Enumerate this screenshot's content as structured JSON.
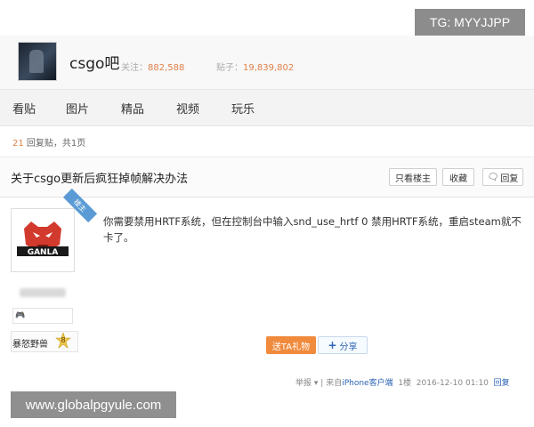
{
  "watermark_top": "TG: MYYJJPP",
  "watermark_bottom": "www.globalpgyule.com",
  "forum": {
    "name": "csgo吧",
    "follow_label": "关注：",
    "follow_count": "882,588",
    "posts_label": "贴子：",
    "posts_count": "19,839,802"
  },
  "nav": [
    "看贴",
    "图片",
    "精品",
    "视频",
    "玩乐"
  ],
  "reply_info": {
    "count": "21",
    "suffix": "回复贴，共1页"
  },
  "thread": {
    "title": "关于csgo更新后疯狂掉帧解决办法",
    "buttons": {
      "only_op": "只看楼主",
      "favorite": "收藏",
      "reply": "回复"
    }
  },
  "user": {
    "corner_tag": "楼主",
    "avatar_text": "GANLA",
    "badge": "🎮",
    "level_name": "暴怒野兽",
    "level": "8"
  },
  "post": {
    "text": "你需要禁用HRTF系统，但在控制台中输入snd_use_hrtf 0 禁用HRTF系统，重启steam就不卡了。",
    "gift_label": "送TA礼物",
    "share_label": "分享"
  },
  "meta": {
    "report": "举报",
    "source_prefix": "| 来自",
    "source_link": "iPhone客户端",
    "floor": "1楼",
    "date": "2016-12-10 01:10",
    "reply": "回复"
  },
  "colors": {
    "accent": "#e0804a",
    "link": "#2d64b3",
    "gift": "#f08a3c"
  }
}
